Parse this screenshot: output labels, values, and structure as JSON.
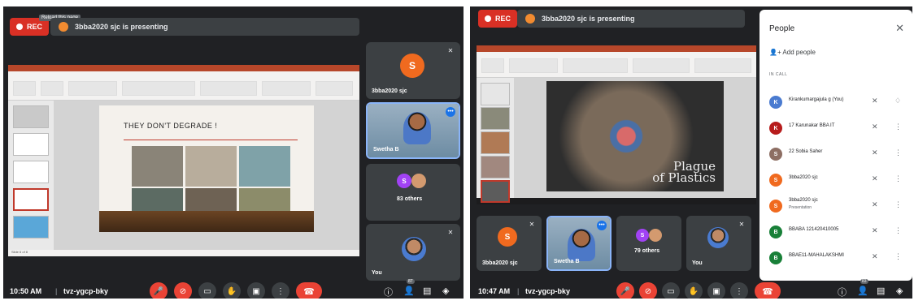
{
  "left": {
    "rec_label": "REC",
    "presenting": "3bba2020 sjc is presenting",
    "tooltip": "Reload this page",
    "slide": {
      "title": "THEY DON'T DEGRADE !",
      "status": "Slide 6 of 8"
    },
    "tiles": [
      {
        "name": "3bba2020 sjc",
        "initial": "S",
        "color": "#f06a1f"
      },
      {
        "name": "Swetha B",
        "more": "•••"
      },
      {
        "initial": "S",
        "color": "#a142f4",
        "label": "83 others"
      },
      {
        "name": "You"
      }
    ],
    "bottom": {
      "time": "10:50 AM",
      "separator": "|",
      "code": "tvz-ygcp-bky",
      "people_count": "87"
    }
  },
  "right": {
    "rec_label": "REC",
    "presenting": "3bba2020 sjc is presenting",
    "slide": {
      "title_line1": "Plague",
      "title_line2": "of Plastics"
    },
    "tiles": [
      {
        "name": "3bba2020 sjc",
        "initial": "S",
        "color": "#f06a1f"
      },
      {
        "name": "Swetha B",
        "more": "•••"
      },
      {
        "initial": "S",
        "color": "#a142f4",
        "label": "79 others"
      },
      {
        "name": "You"
      }
    ],
    "bottom": {
      "time": "10:47 AM",
      "separator": "|",
      "code": "tvz-ygcp-bky",
      "people_count": "83"
    },
    "people_panel": {
      "title": "People",
      "add_label": "Add people",
      "section": "IN CALL",
      "participants": [
        {
          "name": "Kirankumargajula g (You)",
          "initial": "K",
          "color": "#4a7bd0"
        },
        {
          "name": "17 Karunakar BBA IT",
          "initial": "K",
          "color": "#b71c1c"
        },
        {
          "name": "22 Sobia Saher",
          "initial": "S",
          "color": "#8d6e63"
        },
        {
          "name": "3bba2020 sjc",
          "initial": "S",
          "color": "#f06a1f"
        },
        {
          "name": "3bba2020 sjc",
          "sub": "Presentation",
          "initial": "S",
          "color": "#f06a1f"
        },
        {
          "name": "BBABA 121420410005",
          "initial": "B",
          "color": "#188038"
        },
        {
          "name": "BBAE11-MAHALAKSHMI",
          "initial": "B",
          "color": "#188038"
        }
      ]
    }
  }
}
